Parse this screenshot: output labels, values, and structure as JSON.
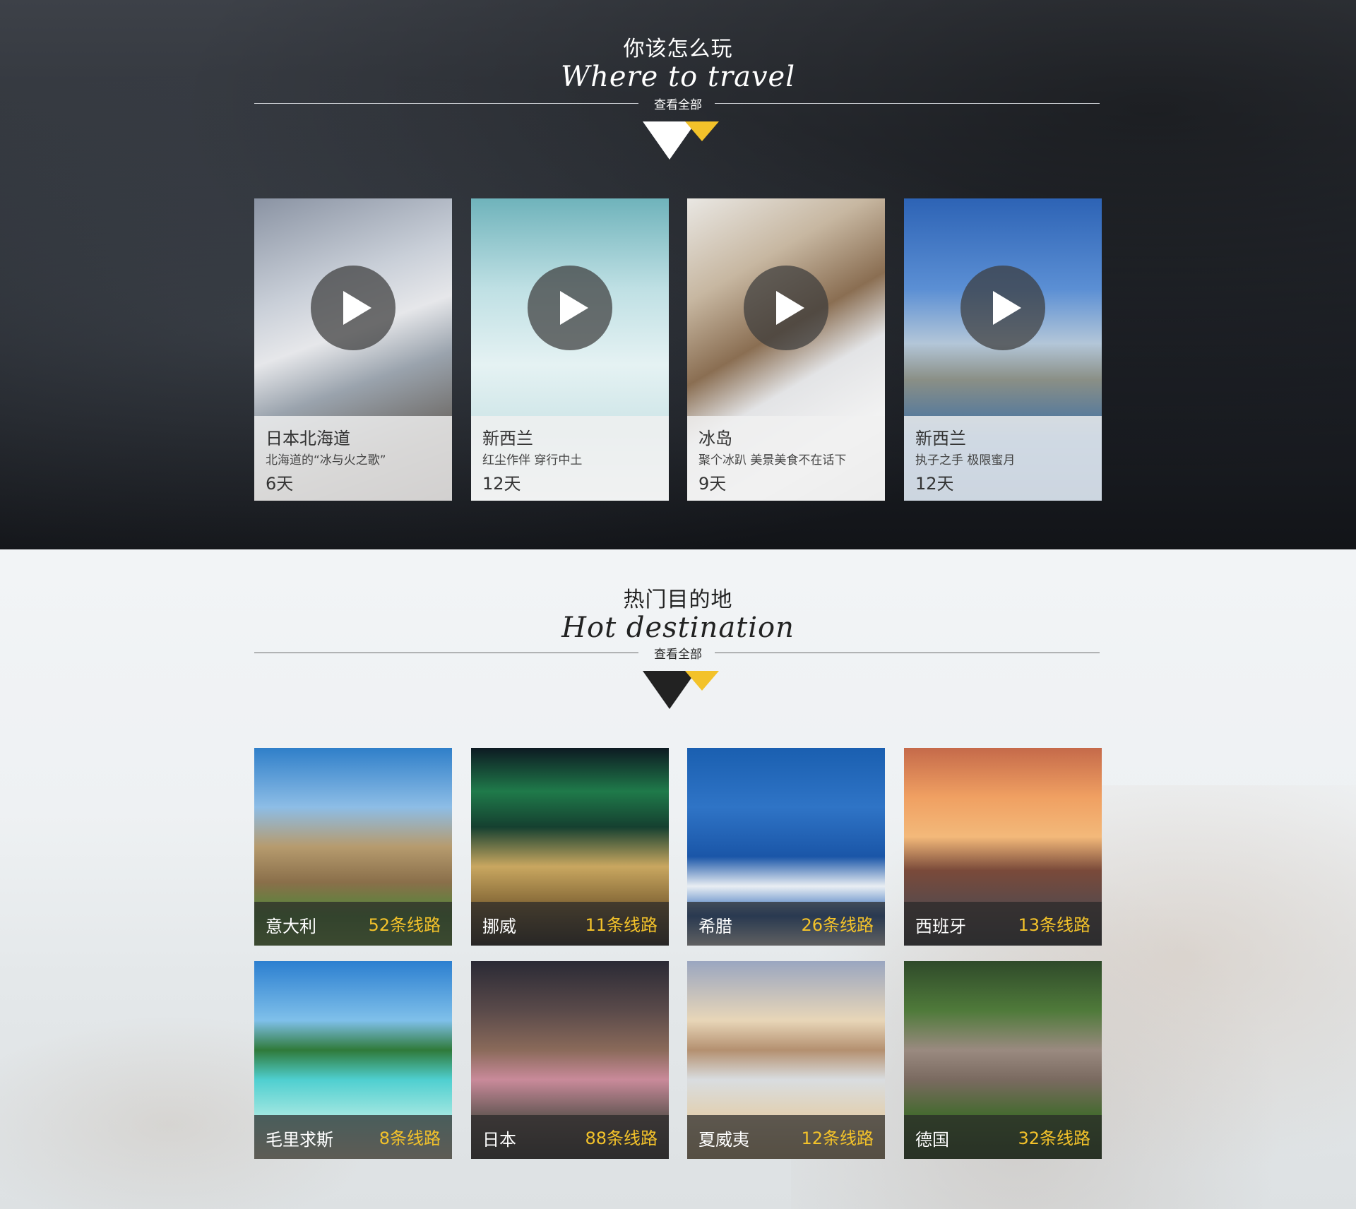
{
  "section_play": {
    "title_cn": "你该怎么玩",
    "title_en": "Where to travel",
    "view_all": "查看全部",
    "cards": [
      {
        "name": "日本北海道",
        "desc": "北海道的“冰与火之歌”",
        "days": "6天"
      },
      {
        "name": "新西兰",
        "desc": "红尘作伴 穿行中土",
        "days": "12天"
      },
      {
        "name": "冰岛",
        "desc": "聚个冰趴 美景美食不在话下",
        "days": "9天"
      },
      {
        "name": "新西兰",
        "desc": "执子之手 极限蜜月",
        "days": "12天"
      }
    ]
  },
  "section_hot": {
    "title_cn": "热门目的地",
    "title_en": "Hot destination",
    "view_all": "查看全部",
    "destinations": [
      {
        "country": "意大利",
        "routes": "52条线路"
      },
      {
        "country": "挪威",
        "routes": "11条线路"
      },
      {
        "country": "希腊",
        "routes": "26条线路"
      },
      {
        "country": "西班牙",
        "routes": "13条线路"
      },
      {
        "country": "毛里求斯",
        "routes": "8条线路"
      },
      {
        "country": "日本",
        "routes": "88条线路"
      },
      {
        "country": "夏威夷",
        "routes": "12条线路"
      },
      {
        "country": "德国",
        "routes": "32条线路"
      }
    ]
  },
  "colors": {
    "accent_yellow": "#f3c22a",
    "dark_triangle": "#222222"
  },
  "icons": {
    "play": "play-icon",
    "triangle": "triangle-marker-icon"
  }
}
